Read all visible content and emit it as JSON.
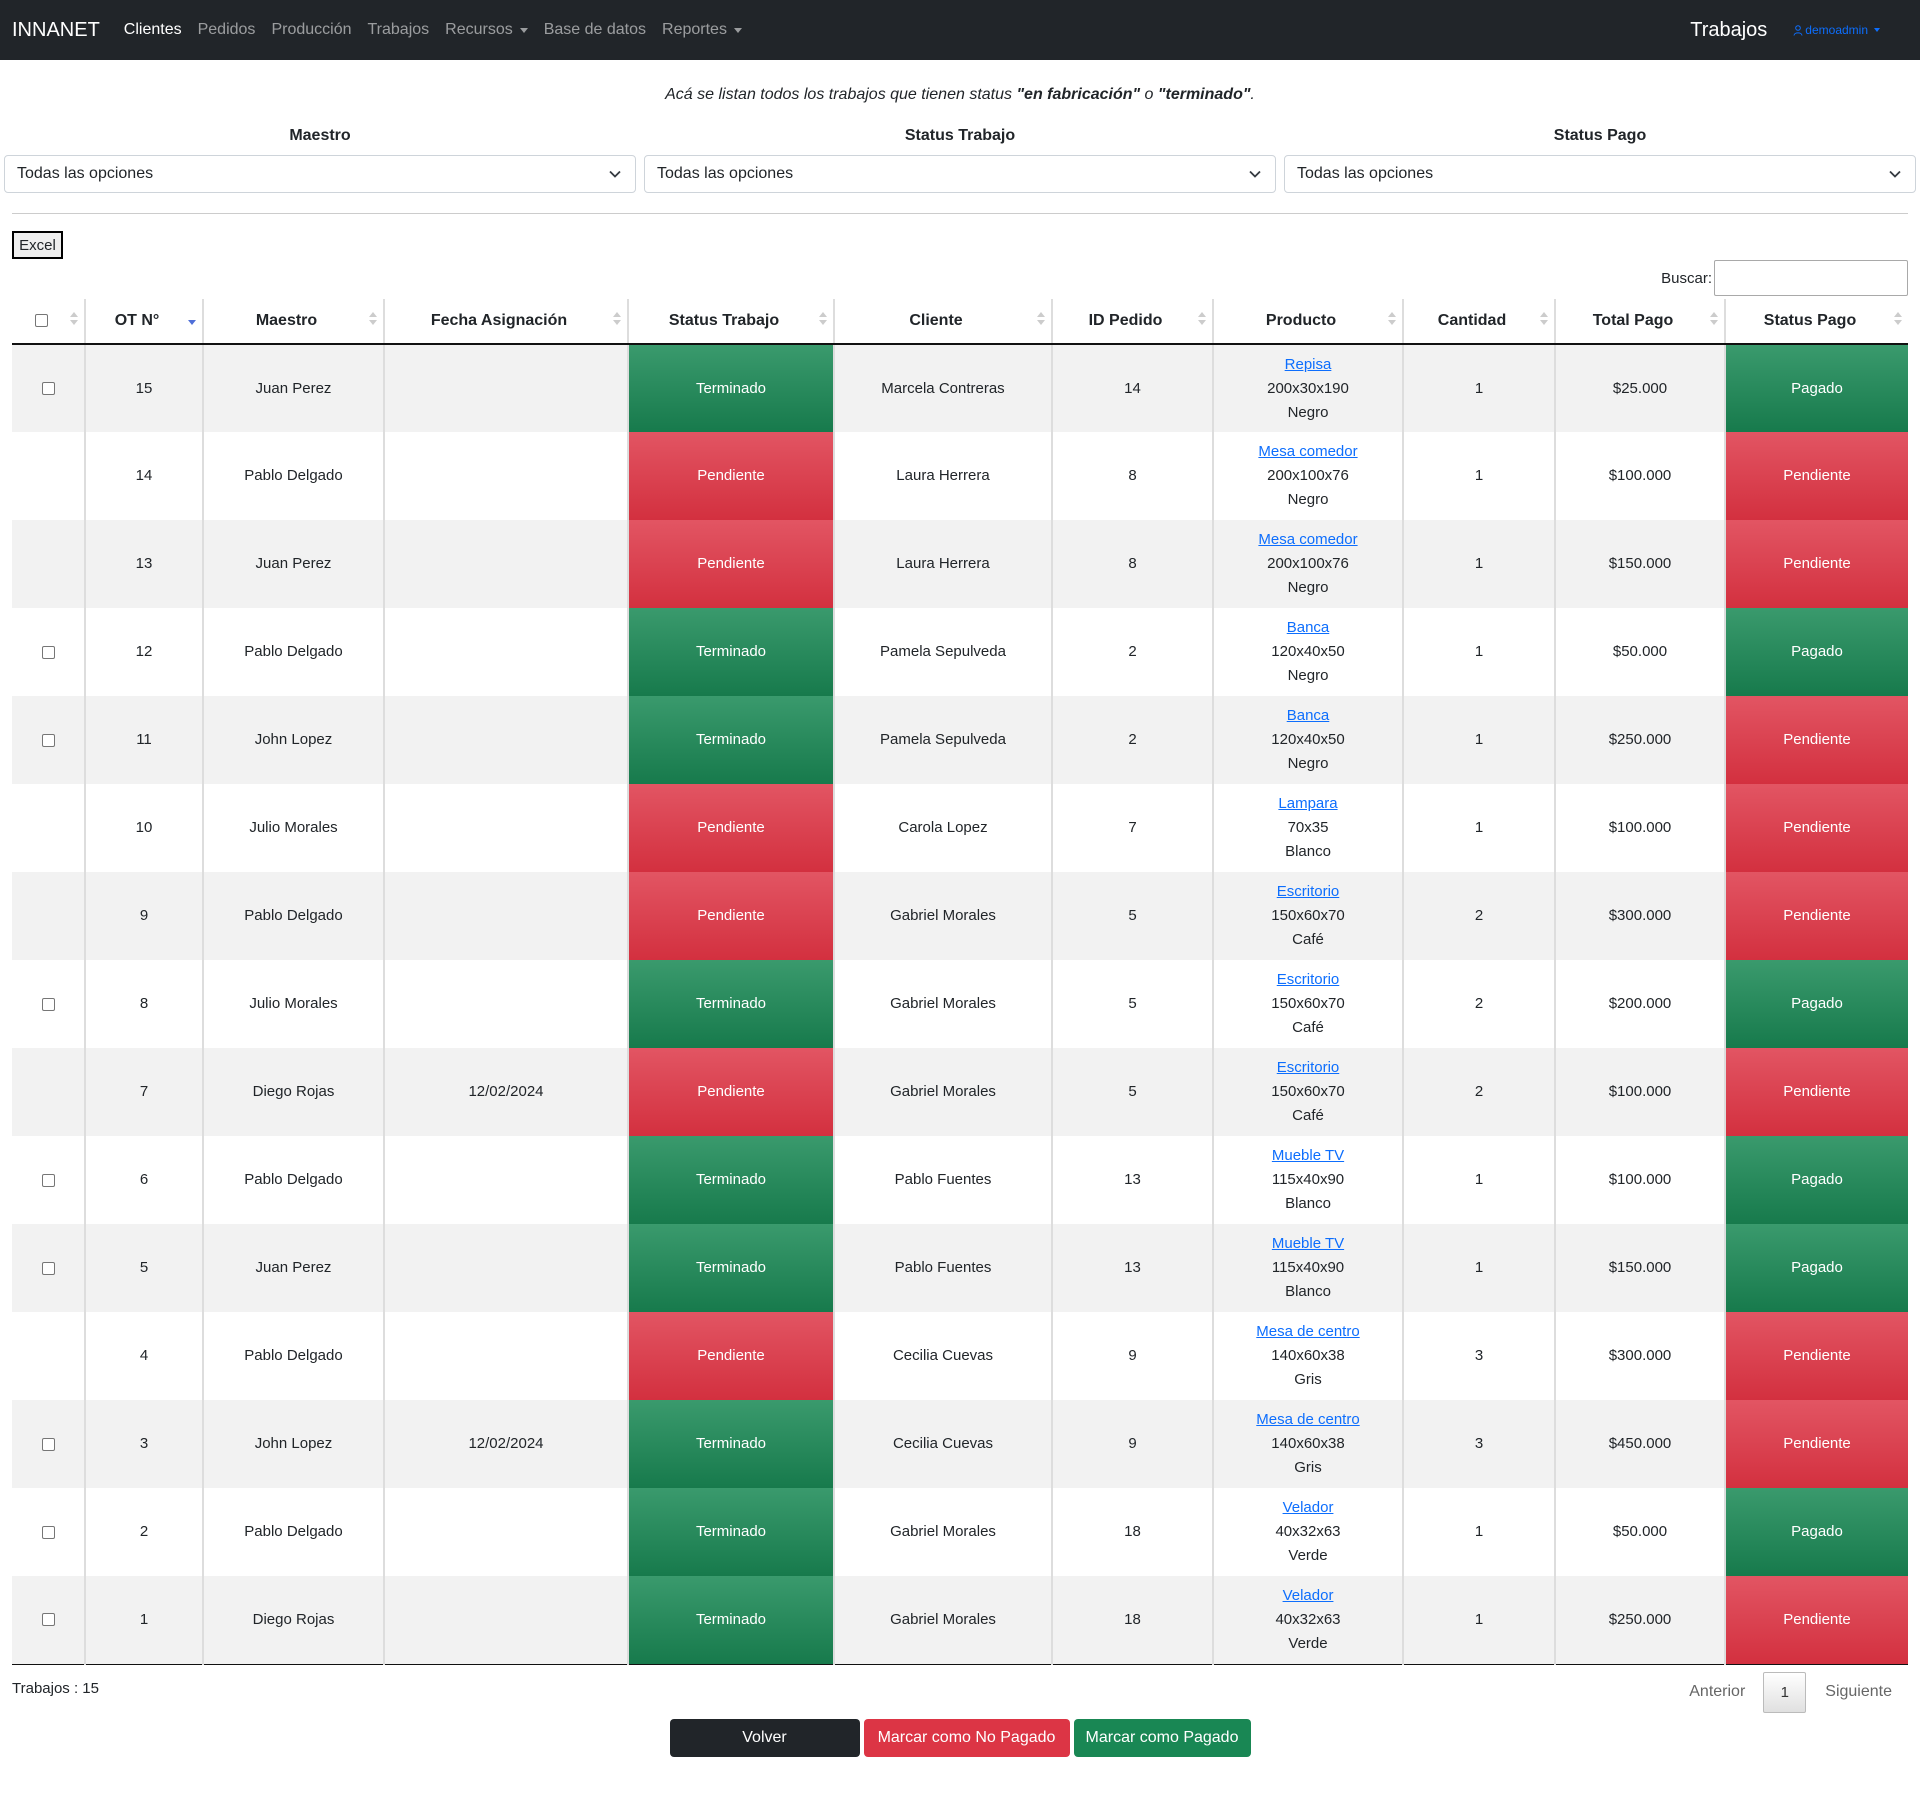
{
  "navbar": {
    "brand": "INNANET",
    "items": [
      {
        "label": "Clientes",
        "active": true,
        "dropdown": false
      },
      {
        "label": "Pedidos",
        "active": false,
        "dropdown": false
      },
      {
        "label": "Producción",
        "active": false,
        "dropdown": false
      },
      {
        "label": "Trabajos",
        "active": false,
        "dropdown": false
      },
      {
        "label": "Recursos",
        "active": false,
        "dropdown": true
      },
      {
        "label": "Base de datos",
        "active": false,
        "dropdown": false
      },
      {
        "label": "Reportes",
        "active": false,
        "dropdown": true
      }
    ],
    "page_title": "Trabajos",
    "user": "demoadmin",
    "user_icon": "user-icon"
  },
  "intro": {
    "prefix": "Acá se listan todos los trabajos que tienen status ",
    "status1": "\"en fabricación\"",
    "middle": " o ",
    "status2": "\"terminado\"",
    "suffix": "."
  },
  "filters": [
    {
      "label": "Maestro",
      "value": "Todas las opciones"
    },
    {
      "label": "Status Trabajo",
      "value": "Todas las opciones"
    },
    {
      "label": "Status Pago",
      "value": "Todas las opciones"
    }
  ],
  "excel_label": "Excel",
  "search_label": "Buscar:",
  "search_value": "",
  "columns": [
    "OT N°",
    "Maestro",
    "Fecha Asignación",
    "Status Trabajo",
    "Cliente",
    "ID Pedido",
    "Producto",
    "Cantidad",
    "Total Pago",
    "Status Pago"
  ],
  "sorted_column": "OT N°",
  "sort_direction": "descending",
  "colors": {
    "green": "#198754",
    "red": "#dc3545",
    "dark": "#212529",
    "link": "#0d6efd"
  },
  "rows": [
    {
      "checkbox": true,
      "ot": "15",
      "maestro": "Juan Perez",
      "fecha": "",
      "status_trabajo": "Terminado",
      "cliente": "Marcela Contreras",
      "id_pedido": "14",
      "producto": "Repisa",
      "medidas": "200x30x190",
      "color": "Negro",
      "cantidad": "1",
      "total": "$25.000",
      "status_pago": "Pagado"
    },
    {
      "checkbox": false,
      "ot": "14",
      "maestro": "Pablo Delgado",
      "fecha": "",
      "status_trabajo": "Pendiente",
      "cliente": "Laura Herrera",
      "id_pedido": "8",
      "producto": "Mesa comedor",
      "medidas": "200x100x76",
      "color": "Negro",
      "cantidad": "1",
      "total": "$100.000",
      "status_pago": "Pendiente"
    },
    {
      "checkbox": false,
      "ot": "13",
      "maestro": "Juan Perez",
      "fecha": "",
      "status_trabajo": "Pendiente",
      "cliente": "Laura Herrera",
      "id_pedido": "8",
      "producto": "Mesa comedor",
      "medidas": "200x100x76",
      "color": "Negro",
      "cantidad": "1",
      "total": "$150.000",
      "status_pago": "Pendiente"
    },
    {
      "checkbox": true,
      "ot": "12",
      "maestro": "Pablo Delgado",
      "fecha": "",
      "status_trabajo": "Terminado",
      "cliente": "Pamela Sepulveda",
      "id_pedido": "2",
      "producto": "Banca",
      "medidas": "120x40x50",
      "color": "Negro",
      "cantidad": "1",
      "total": "$50.000",
      "status_pago": "Pagado"
    },
    {
      "checkbox": true,
      "ot": "11",
      "maestro": "John Lopez",
      "fecha": "",
      "status_trabajo": "Terminado",
      "cliente": "Pamela Sepulveda",
      "id_pedido": "2",
      "producto": "Banca",
      "medidas": "120x40x50",
      "color": "Negro",
      "cantidad": "1",
      "total": "$250.000",
      "status_pago": "Pendiente"
    },
    {
      "checkbox": false,
      "ot": "10",
      "maestro": "Julio Morales",
      "fecha": "",
      "status_trabajo": "Pendiente",
      "cliente": "Carola Lopez",
      "id_pedido": "7",
      "producto": "Lampara",
      "medidas": "70x35",
      "color": "Blanco",
      "cantidad": "1",
      "total": "$100.000",
      "status_pago": "Pendiente"
    },
    {
      "checkbox": false,
      "ot": "9",
      "maestro": "Pablo Delgado",
      "fecha": "",
      "status_trabajo": "Pendiente",
      "cliente": "Gabriel Morales",
      "id_pedido": "5",
      "producto": "Escritorio",
      "medidas": "150x60x70",
      "color": "Café",
      "cantidad": "2",
      "total": "$300.000",
      "status_pago": "Pendiente"
    },
    {
      "checkbox": true,
      "ot": "8",
      "maestro": "Julio Morales",
      "fecha": "",
      "status_trabajo": "Terminado",
      "cliente": "Gabriel Morales",
      "id_pedido": "5",
      "producto": "Escritorio",
      "medidas": "150x60x70",
      "color": "Café",
      "cantidad": "2",
      "total": "$200.000",
      "status_pago": "Pagado"
    },
    {
      "checkbox": false,
      "ot": "7",
      "maestro": "Diego Rojas",
      "fecha": "12/02/2024",
      "status_trabajo": "Pendiente",
      "cliente": "Gabriel Morales",
      "id_pedido": "5",
      "producto": "Escritorio",
      "medidas": "150x60x70",
      "color": "Café",
      "cantidad": "2",
      "total": "$100.000",
      "status_pago": "Pendiente"
    },
    {
      "checkbox": true,
      "ot": "6",
      "maestro": "Pablo Delgado",
      "fecha": "",
      "status_trabajo": "Terminado",
      "cliente": "Pablo Fuentes",
      "id_pedido": "13",
      "producto": "Mueble TV",
      "medidas": "115x40x90",
      "color": "Blanco",
      "cantidad": "1",
      "total": "$100.000",
      "status_pago": "Pagado"
    },
    {
      "checkbox": true,
      "ot": "5",
      "maestro": "Juan Perez",
      "fecha": "",
      "status_trabajo": "Terminado",
      "cliente": "Pablo Fuentes",
      "id_pedido": "13",
      "producto": "Mueble TV",
      "medidas": "115x40x90",
      "color": "Blanco",
      "cantidad": "1",
      "total": "$150.000",
      "status_pago": "Pagado"
    },
    {
      "checkbox": false,
      "ot": "4",
      "maestro": "Pablo Delgado",
      "fecha": "",
      "status_trabajo": "Pendiente",
      "cliente": "Cecilia Cuevas",
      "id_pedido": "9",
      "producto": "Mesa de centro",
      "medidas": "140x60x38",
      "color": "Gris",
      "cantidad": "3",
      "total": "$300.000",
      "status_pago": "Pendiente"
    },
    {
      "checkbox": true,
      "ot": "3",
      "maestro": "John Lopez",
      "fecha": "12/02/2024",
      "status_trabajo": "Terminado",
      "cliente": "Cecilia Cuevas",
      "id_pedido": "9",
      "producto": "Mesa de centro",
      "medidas": "140x60x38",
      "color": "Gris",
      "cantidad": "3",
      "total": "$450.000",
      "status_pago": "Pendiente"
    },
    {
      "checkbox": true,
      "ot": "2",
      "maestro": "Pablo Delgado",
      "fecha": "",
      "status_trabajo": "Terminado",
      "cliente": "Gabriel Morales",
      "id_pedido": "18",
      "producto": "Velador",
      "medidas": "40x32x63",
      "color": "Verde",
      "cantidad": "1",
      "total": "$50.000",
      "status_pago": "Pagado"
    },
    {
      "checkbox": true,
      "ot": "1",
      "maestro": "Diego Rojas",
      "fecha": "",
      "status_trabajo": "Terminado",
      "cliente": "Gabriel Morales",
      "id_pedido": "18",
      "producto": "Velador",
      "medidas": "40x32x63",
      "color": "Verde",
      "cantidad": "1",
      "total": "$250.000",
      "status_pago": "Pendiente"
    }
  ],
  "footer": {
    "count_label": "Trabajos : 15",
    "prev": "Anterior",
    "page": "1",
    "next": "Siguiente"
  },
  "actions": {
    "back": "Volver",
    "mark_unpaid": "Marcar como No Pagado",
    "mark_paid": "Marcar como Pagado"
  }
}
